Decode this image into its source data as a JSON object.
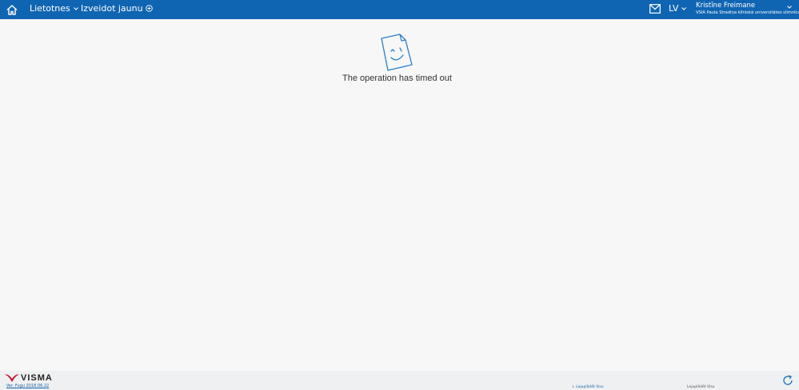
{
  "topbar": {
    "nav": [
      {
        "label": "Lietotnes",
        "icon": "chevron-down-icon"
      },
      {
        "label": "Izveidot jaunu",
        "icon": "plus-circle-icon"
      }
    ],
    "language": "LV",
    "user": {
      "name": "Kristīne Freimane",
      "organization": "VSIA Paula Stradiņa klīniskā universitātes slimnīca"
    },
    "bg_color": "#1065b3"
  },
  "main": {
    "message": "The operation has timed out",
    "icon": "smiling-document-icon",
    "icon_color": "#2a7fc8"
  },
  "footer": {
    "logo_text": "VISMA",
    "version": "Ver. Fugu 2018.06.22",
    "link1": "↓ Lejuplādēt Visu",
    "link2": "Lejuplādēt Visu"
  }
}
